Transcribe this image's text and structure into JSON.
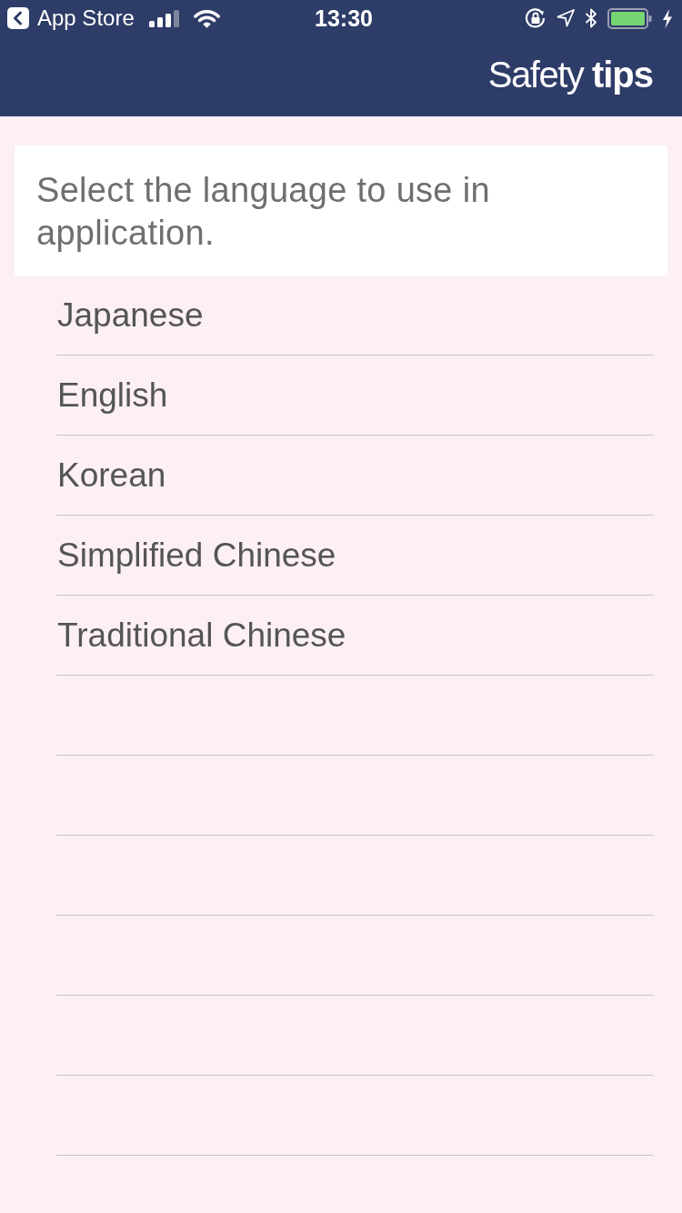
{
  "status_bar": {
    "back_label": "App Store",
    "time": "13:30"
  },
  "nav_bar": {
    "title": "Safety **tips**"
  },
  "prompt": "Select the language to use in application.",
  "languages": [
    "Japanese",
    "English",
    "Korean",
    "Simplified Chinese",
    "Traditional Chinese"
  ]
}
